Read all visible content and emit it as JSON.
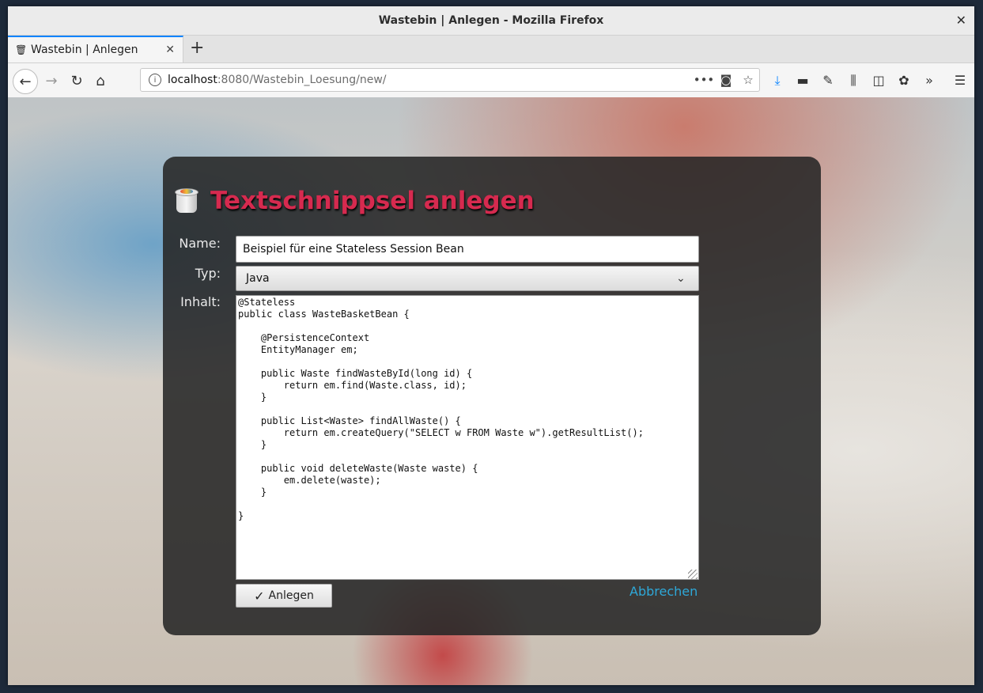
{
  "window": {
    "title": "Wastebin | Anlegen - Mozilla Firefox",
    "close_glyph": "✕"
  },
  "tab": {
    "title": "Wastebin | Anlegen",
    "close_glyph": "✕",
    "new_tab_glyph": "+"
  },
  "nav": {
    "url_host": "localhost",
    "url_path": ":8080/Wastebin_Loesung/new/",
    "icons": [
      "back-icon",
      "forward-icon",
      "reload-icon",
      "home-icon",
      "info-icon",
      "more-icon",
      "pocket-icon",
      "bookmark-star-icon",
      "downloads-icon",
      "sync-icon",
      "tools-icon",
      "library-icon",
      "sidebar-icon",
      "extension-icon",
      "overflow-icon",
      "menu-icon"
    ]
  },
  "form": {
    "heading": "Textschnippsel anlegen",
    "name_label": "Name:",
    "name_value": "Beispiel für eine Stateless Session Bean",
    "type_label": "Typ:",
    "type_value": "Java",
    "content_label": "Inhalt:",
    "content_value": "@Stateless\npublic class WasteBasketBean {\n\n    @PersistenceContext\n    EntityManager em;\n\n    public Waste findWasteById(long id) {\n        return em.find(Waste.class, id);\n    }\n\n    public List<Waste> findAllWaste() {\n        return em.createQuery(\"SELECT w FROM Waste w\").getResultList();\n    }\n\n    public void deleteWaste(Waste waste) {\n        em.delete(waste);\n    }\n\n}",
    "submit_label": "Anlegen",
    "cancel_label": "Abbrechen"
  },
  "colors": {
    "heading": "#d62a4f",
    "cancel_link": "#2ea8d8",
    "tab_accent": "#0a84ff"
  }
}
